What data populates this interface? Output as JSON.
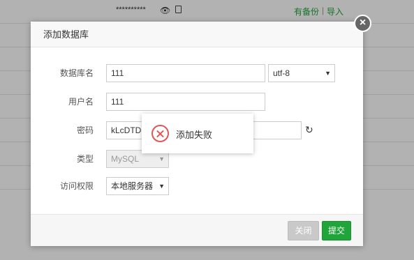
{
  "background": {
    "password_mask": "**********",
    "backup_link": "有备份",
    "separator": "|",
    "import_link": "导入"
  },
  "dialog": {
    "title": "添加数据库",
    "close_icon": "×",
    "fields": {
      "db_name_label": "数据库名",
      "db_name_value": "111",
      "charset_value": "utf-8",
      "username_label": "用户名",
      "username_value": "111",
      "password_label": "密码",
      "password_value": "kLcDTD",
      "type_label": "类型",
      "type_value": "MySQL",
      "access_label": "访问权限",
      "access_value": "本地服务器"
    },
    "footer": {
      "close_label": "关闭",
      "submit_label": "提交"
    }
  },
  "toast": {
    "message": "添加失败",
    "icon": "error-x-icon"
  },
  "colors": {
    "accent_green": "#20a53a",
    "error_red": "#e15656"
  }
}
